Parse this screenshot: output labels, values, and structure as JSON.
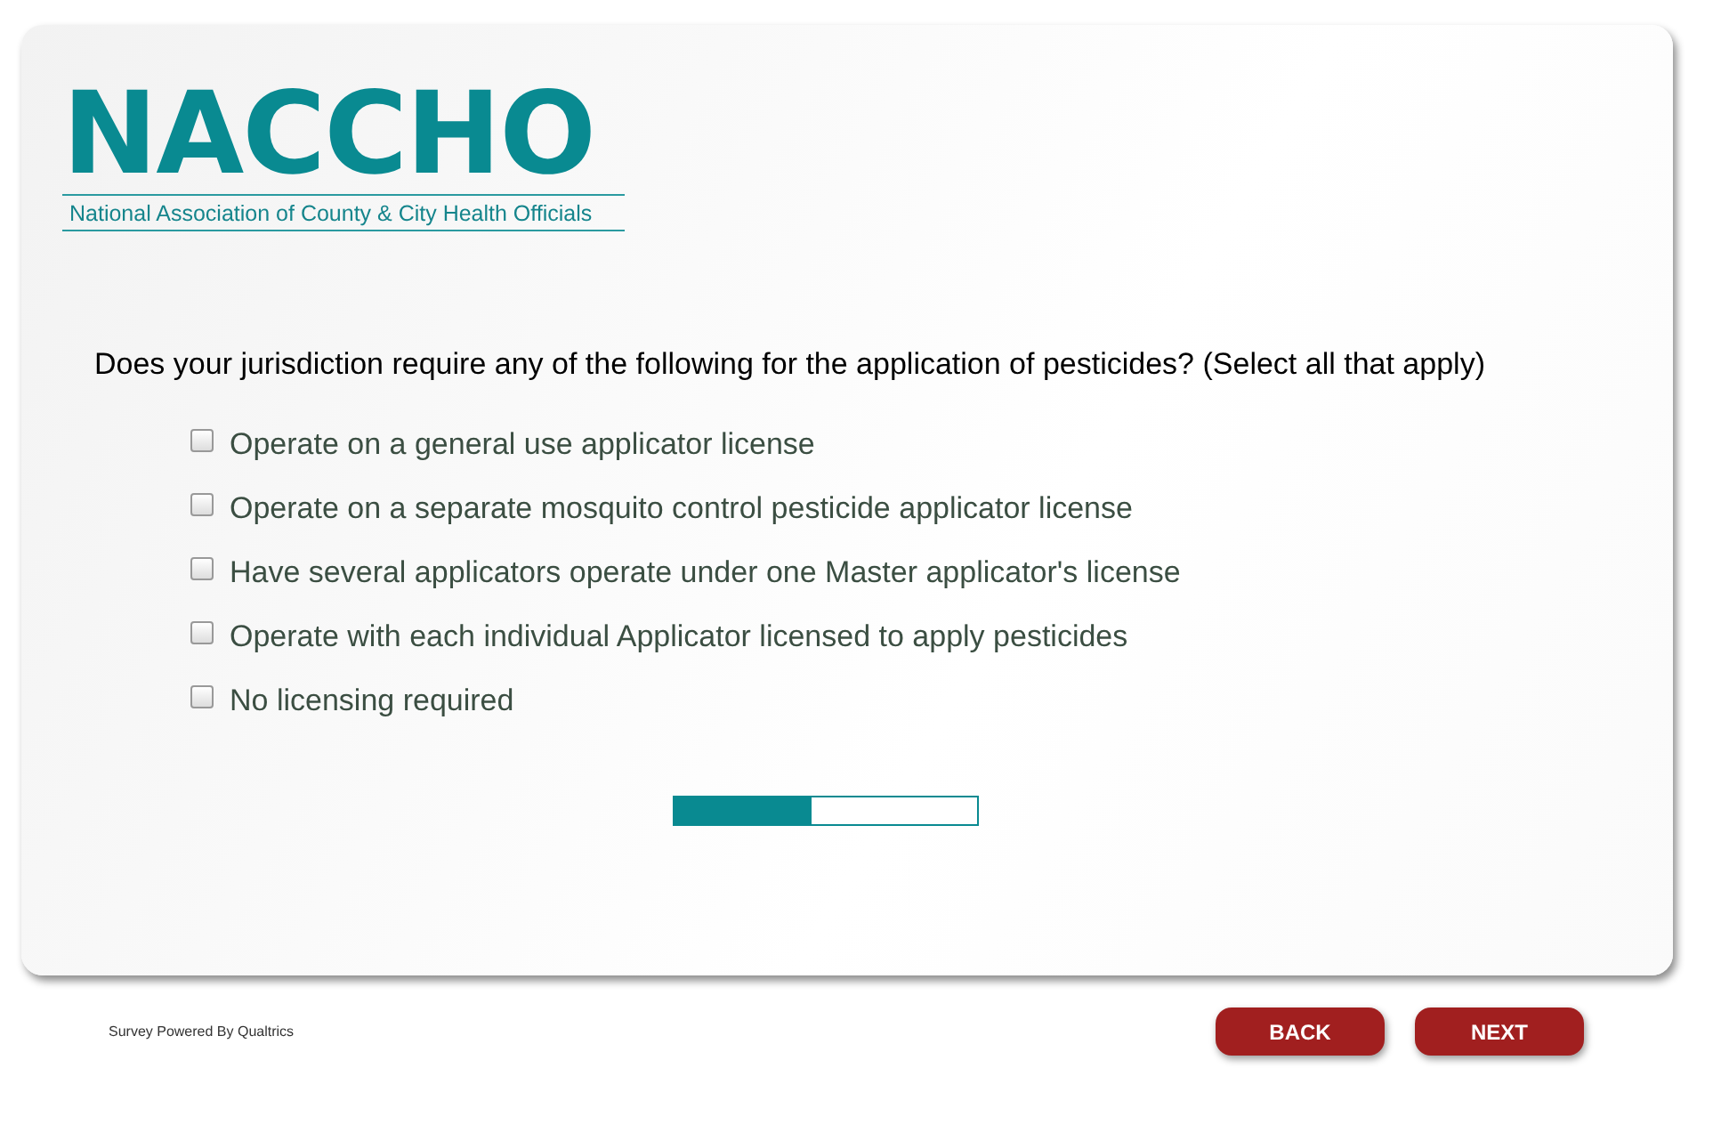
{
  "logo": {
    "name": "NACCHO",
    "subtitle": "National Association of County & City Health Officials"
  },
  "question": {
    "text": "Does your jurisdiction require any of the following for the application of pesticides? (Select all that apply)",
    "options": [
      {
        "label": "Operate on a general use applicator license",
        "checked": false
      },
      {
        "label": "Operate on a separate mosquito control pesticide applicator license",
        "checked": false
      },
      {
        "label": "Have several applicators operate under one Master applicator's license",
        "checked": false
      },
      {
        "label": "Operate with each individual Applicator licensed to apply pesticides",
        "checked": false
      },
      {
        "label": "No licensing required",
        "checked": false
      }
    ]
  },
  "progress": {
    "level": 0.45
  },
  "footer": {
    "credit": "Survey Powered By Qualtrics"
  },
  "buttons": [
    "BACK",
    "NEXT"
  ]
}
